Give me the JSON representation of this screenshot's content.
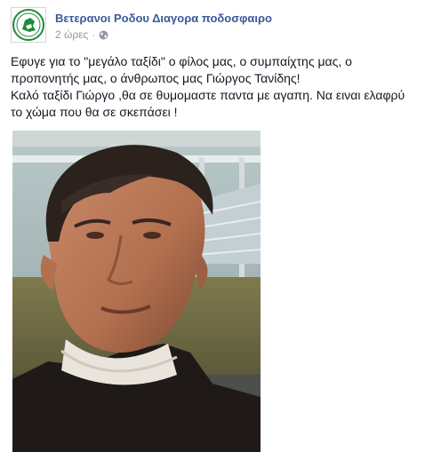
{
  "page": {
    "name": "Βετερανοι Ροδου Διαγορα ποδοσφαιρο"
  },
  "post": {
    "time": "2 ώρες",
    "separator": "·",
    "audience_icon": "globe-icon",
    "text_lines": [
      "Εφυγε για το \"μεγάλο ταξίδι\" ο φίλος μας, ο συμπαίχτης μας, ο",
      "προπονητής μας, ο άνθρωπος μας Γιώργος Τανίδης!",
      "Καλό ταξίδι Γιώργο ,θα σε θυμομαστε παντα με αγαπη. Να ειναι ελαφρύ",
      "το χώμα που θα σε σκεπάσει !"
    ]
  },
  "colors": {
    "link": "#3b5998",
    "meta": "#9197a3",
    "text": "#141823",
    "logo_green": "#1f8a3b"
  }
}
